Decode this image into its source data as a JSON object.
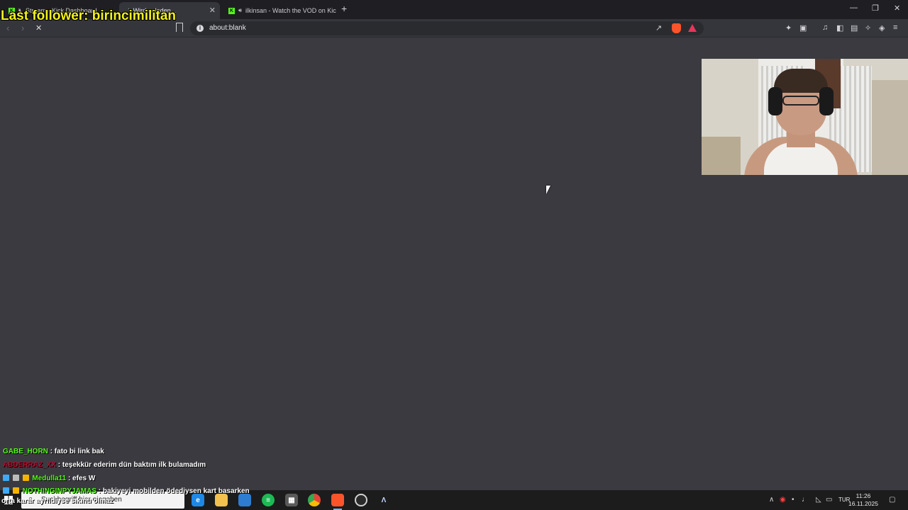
{
  "browser": {
    "tabs": [
      {
        "title": "Stream - Kick Dashboard",
        "active": false
      },
      {
        "title": "Wird geladen...",
        "active": true
      },
      {
        "title": "ilkinsan - Watch the VOD on Kick",
        "active": false
      }
    ],
    "url": "about:blank",
    "new_tab_symbol": "+"
  },
  "overlay": {
    "last_follower": "Last follower: birincimilitan",
    "ticker": "orta karar ayrıldiyse sıkıntı olmaz"
  },
  "chat": [
    {
      "user": "GABE_HORN",
      "message": ": fato bi link bak",
      "user_color": "#53fc18"
    },
    {
      "user": "ABDERRAZ_XX",
      "message": ": teşekkür ederim dün baktım ilk bulamadım",
      "user_color": "#b01030"
    },
    {
      "user": "Medulla11",
      "message": ": efes W",
      "user_color": "#53fc18"
    },
    {
      "user": "NOTHINGINPYJAMAS",
      "message": ": bakiyeyi mobilden ödediysen kart basarken",
      "user_color": "#53fc18"
    }
  ],
  "taskbar": {
    "search_placeholder": "Suchbegriff hier eingeben",
    "language": "TUR",
    "time": "11:26",
    "date": "16.11.2025",
    "apps": [
      "edge-icon",
      "file-explorer-icon",
      "store-icon",
      "spotify-icon",
      "calculator-icon",
      "chrome-icon",
      "brave-icon",
      "obs-icon",
      "app-icon"
    ]
  },
  "colors": {
    "page_background": "#3a3a40",
    "follower_text": "#f2f21a",
    "kick_green": "#53fc18",
    "brave_orange": "#fb542b"
  }
}
